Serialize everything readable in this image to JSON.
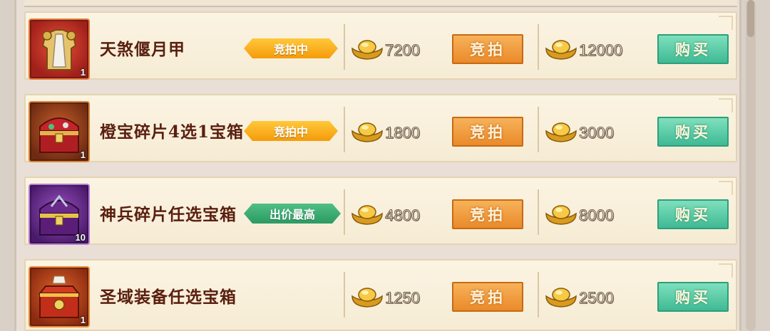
{
  "colors": {
    "item_name": "#5a1f10",
    "bid_button": "#ea8a2a",
    "buy_button": "#3fba94",
    "status_bidding": "#f59b0a",
    "status_highest": "#2c9a63"
  },
  "actions": {
    "bid_label": "竞拍",
    "buy_label": "购买"
  },
  "items": [
    {
      "name": "天煞偃月甲",
      "icon": "armor-icon",
      "icon_bg": "#b52a1e",
      "count": "1",
      "status": "竞拍中",
      "status_type": "bidding",
      "bid_price": "7200",
      "buy_price": "12000"
    },
    {
      "name": "橙宝碎片4选1宝箱",
      "icon": "orange-chest-icon",
      "icon_bg": "#8a3a18",
      "count": "1",
      "status": "竞拍中",
      "status_type": "bidding",
      "bid_price": "1800",
      "buy_price": "3000"
    },
    {
      "name": "神兵碎片任选宝箱",
      "icon": "purple-chest-icon",
      "icon_bg": "#6a2c8a",
      "count": "10",
      "status": "出价最高",
      "status_type": "highest",
      "bid_price": "4800",
      "buy_price": "8000"
    },
    {
      "name": "圣域装备任选宝箱",
      "icon": "red-chest-icon",
      "icon_bg": "#b53a14",
      "count": "1",
      "status": "",
      "status_type": "none",
      "bid_price": "1250",
      "buy_price": "2500"
    }
  ]
}
